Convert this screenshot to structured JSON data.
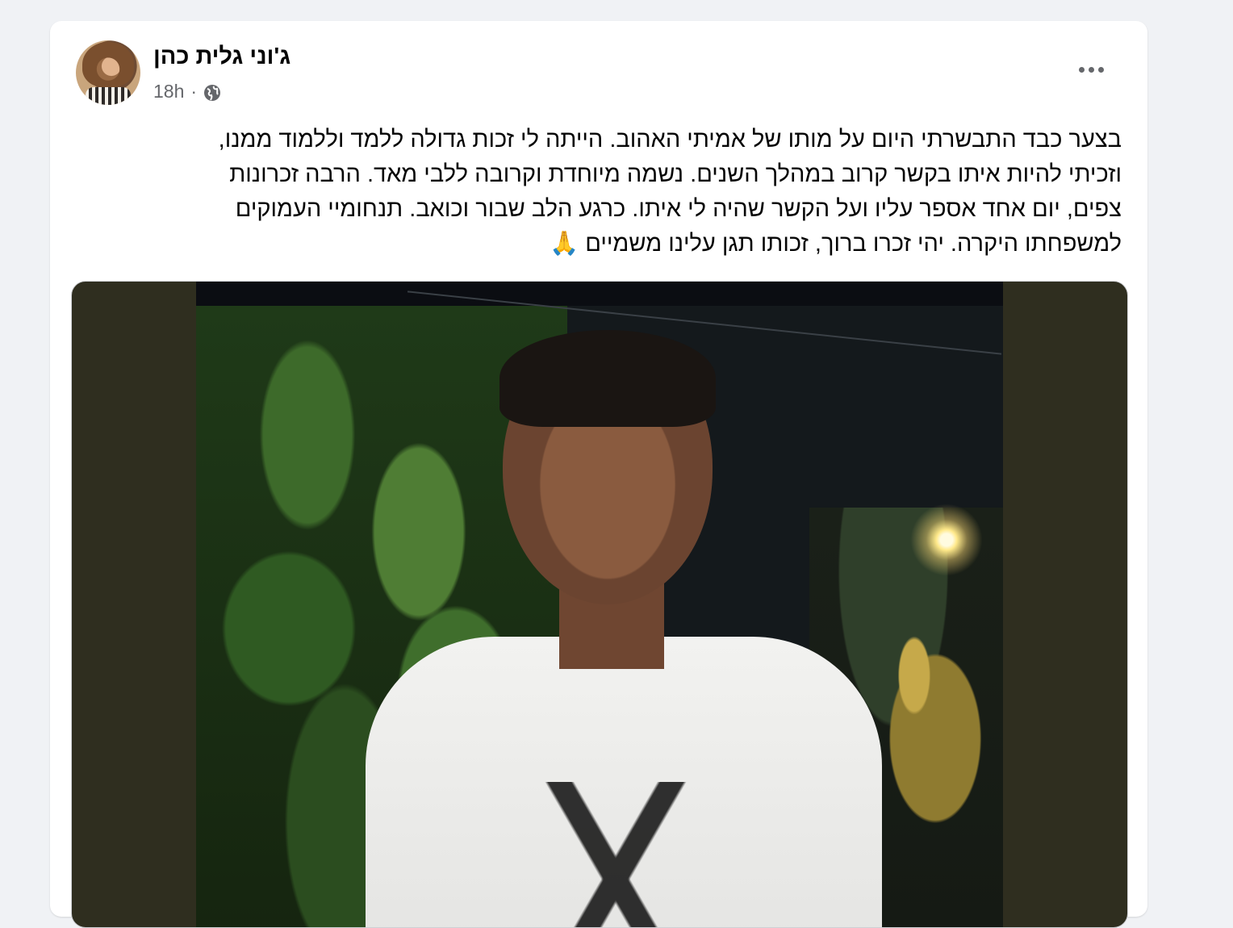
{
  "post": {
    "author_name": "ג'וני גלית כהן",
    "timestamp": "18h",
    "separator": "·",
    "privacy_icon": "globe-icon",
    "more_icon": "more-horizontal-icon",
    "text_lines": [
      "בצער כבד התבשרתי היום על מותו של אמיתי האהוב. הייתה לי זכות גדולה ללמד וללמוד ממנו,",
      "וזכיתי להיות איתו בקשר קרוב במהלך השנים. נשמה מיוחדת וקרובה ללבי מאד. הרבה זכרונות",
      "צפים, יום אחד אספר עליו ועל הקשר  שהיה לי איתו. כרגע הלב שבור וכואב. תנחומיי העמוקים",
      "למשפחתו היקרה. יהי זכרו ברוך, זכותו תגן עלינו משמיים 🙏"
    ],
    "media": {
      "type": "photo",
      "background_color": "#2f2e1f"
    }
  }
}
